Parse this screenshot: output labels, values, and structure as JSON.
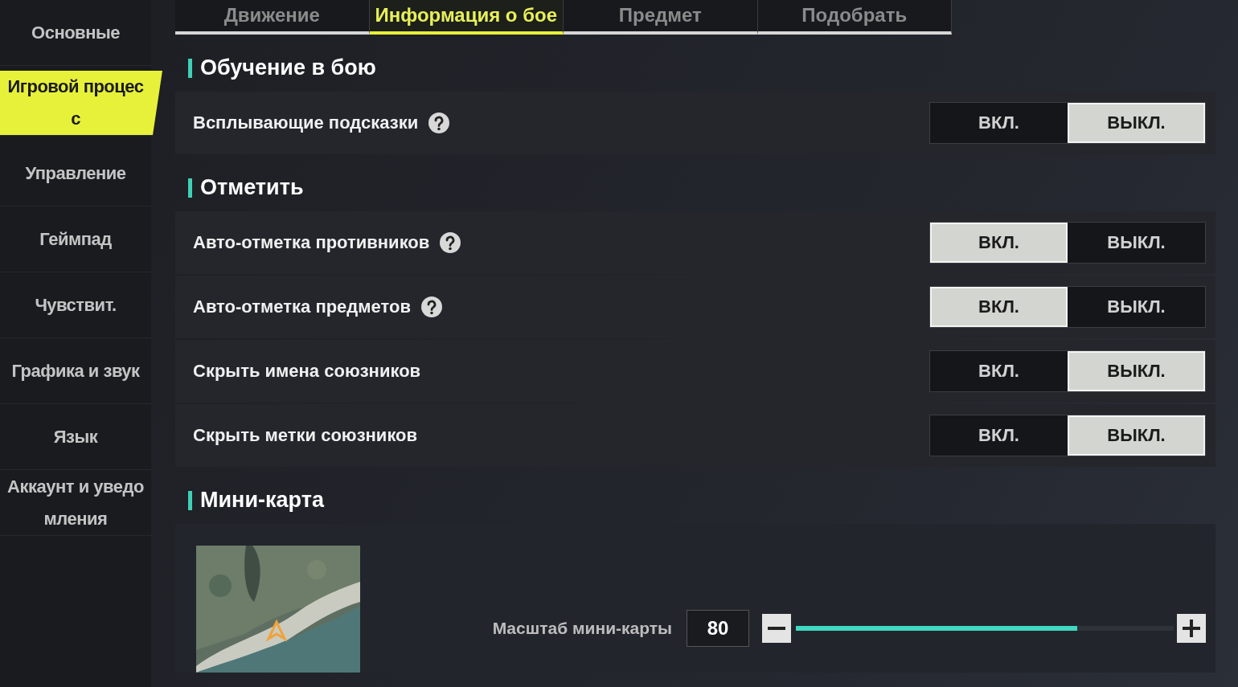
{
  "sidebar": {
    "items": [
      {
        "label": "Основные",
        "selected": false
      },
      {
        "label": "Игровой процесс",
        "selected": true
      },
      {
        "label": "Управление",
        "selected": false
      },
      {
        "label": "Геймпад",
        "selected": false
      },
      {
        "label": "Чувствит.",
        "selected": false
      },
      {
        "label": "Графика и звук",
        "selected": false
      },
      {
        "label": "Язык",
        "selected": false
      },
      {
        "label": "Аккаунт и уведомления",
        "selected": false
      }
    ]
  },
  "tabs": [
    {
      "label": "Движение",
      "selected": false
    },
    {
      "label": "Информация о бое",
      "selected": true
    },
    {
      "label": "Предмет",
      "selected": false
    },
    {
      "label": "Подобрать",
      "selected": false
    }
  ],
  "sections": [
    {
      "title": "Обучение в бою",
      "rows": [
        {
          "label": "Всплывающие подсказки",
          "help": true,
          "options": [
            {
              "label": "ВКЛ.",
              "selected": false
            },
            {
              "label": "ВЫКЛ.",
              "selected": true
            }
          ]
        }
      ]
    },
    {
      "title": "Отметить",
      "rows": [
        {
          "label": "Авто-отметка противников",
          "help": true,
          "options": [
            {
              "label": "ВКЛ.",
              "selected": true
            },
            {
              "label": "ВЫКЛ.",
              "selected": false
            }
          ]
        },
        {
          "label": "Авто-отметка предметов",
          "help": true,
          "options": [
            {
              "label": "ВКЛ.",
              "selected": true
            },
            {
              "label": "ВЫКЛ.",
              "selected": false
            }
          ]
        },
        {
          "label": "Скрыть имена союзников",
          "help": false,
          "options": [
            {
              "label": "ВКЛ.",
              "selected": false
            },
            {
              "label": "ВЫКЛ.",
              "selected": true
            }
          ]
        },
        {
          "label": "Скрыть метки союзников",
          "help": false,
          "options": [
            {
              "label": "ВКЛ.",
              "selected": false
            },
            {
              "label": "ВЫКЛ.",
              "selected": true
            }
          ]
        }
      ]
    }
  ],
  "minimap": {
    "title": "Мини-карта",
    "scale_label": "Масштаб мини-карты",
    "scale_value": "80",
    "level": 0.745
  }
}
